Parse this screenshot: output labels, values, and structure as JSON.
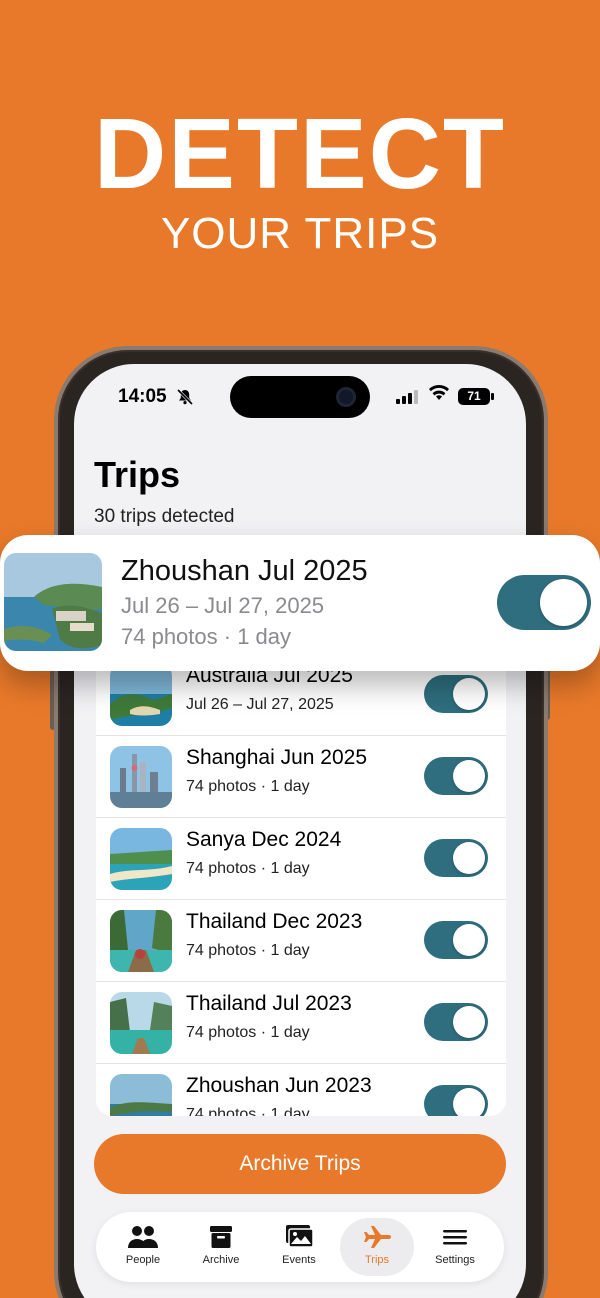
{
  "promo": {
    "headline": "DETECT",
    "subline": "YOUR TRIPS"
  },
  "status_bar": {
    "time": "14:05",
    "battery": "71"
  },
  "header": {
    "title": "Trips",
    "subtitle": "30 trips detected"
  },
  "featured_trip": {
    "title": "Zhoushan Jul 2025",
    "dates": "Jul 26 – Jul 27, 2025",
    "meta": "74 photos · 1 day",
    "enabled": true
  },
  "trips": [
    {
      "title": "Australia Jul 2025",
      "meta": "Jul 26 – Jul 27, 2025",
      "enabled": true
    },
    {
      "title": "Shanghai Jun 2025",
      "meta": "74 photos · 1 day",
      "enabled": true
    },
    {
      "title": "Sanya Dec 2024",
      "meta": "74 photos · 1 day",
      "enabled": true
    },
    {
      "title": "Thailand Dec 2023",
      "meta": "74 photos · 1 day",
      "enabled": true
    },
    {
      "title": "Thailand Jul 2023",
      "meta": "74 photos · 1 day",
      "enabled": true
    },
    {
      "title": "Zhoushan Jun 2023",
      "meta": "74 photos · 1 day",
      "enabled": true
    }
  ],
  "actions": {
    "archive_label": "Archive Trips"
  },
  "tabbar": {
    "items": [
      {
        "label": "People",
        "icon": "people-icon"
      },
      {
        "label": "Archive",
        "icon": "archive-icon"
      },
      {
        "label": "Events",
        "icon": "events-icon"
      },
      {
        "label": "Trips",
        "icon": "airplane-icon",
        "active": true
      },
      {
        "label": "Settings",
        "icon": "settings-icon"
      }
    ]
  },
  "colors": {
    "accent": "#E8792A",
    "toggle_on": "#2E6E7E",
    "background": "#F2F2F5"
  }
}
